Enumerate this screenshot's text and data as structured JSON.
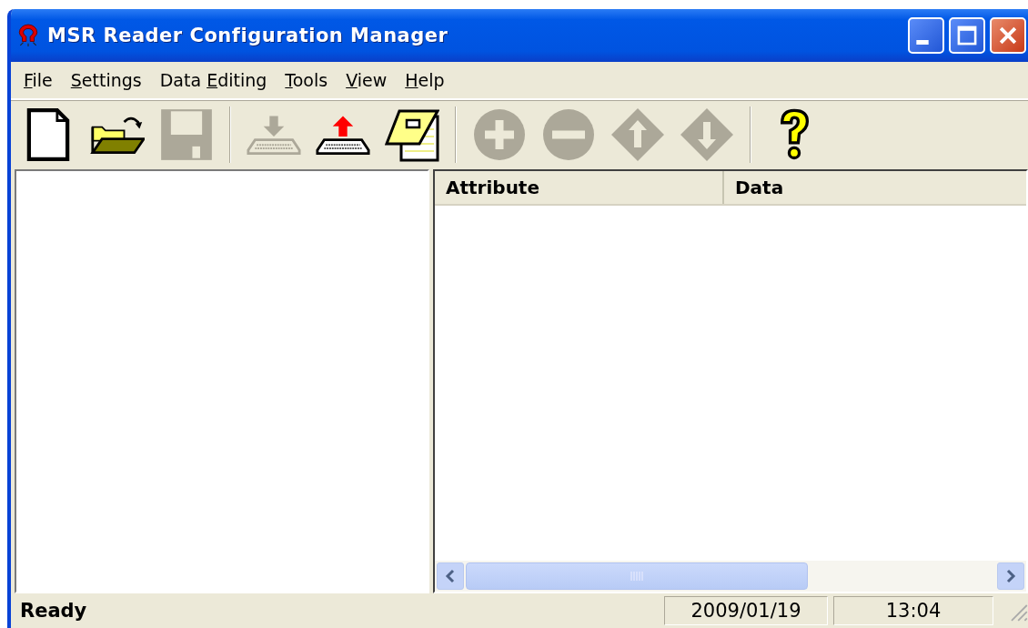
{
  "window": {
    "title": "MSR Reader Configuration Manager"
  },
  "menu": [
    {
      "key": "F",
      "post": "ile"
    },
    {
      "key": "S",
      "post": "ettings"
    },
    {
      "pre": "Data ",
      "key": "E",
      "post": "diting"
    },
    {
      "key": "T",
      "post": "ools"
    },
    {
      "key": "V",
      "post": "iew"
    },
    {
      "key": "H",
      "post": "elp"
    }
  ],
  "toolbar": [
    [
      {
        "kind": "new",
        "disabled": false
      },
      {
        "kind": "open",
        "disabled": false
      },
      {
        "kind": "save",
        "disabled": true
      }
    ],
    [
      {
        "kind": "download",
        "disabled": true
      },
      {
        "kind": "upload",
        "disabled": false
      },
      {
        "kind": "notepad",
        "disabled": false
      }
    ],
    [
      {
        "kind": "add",
        "disabled": true
      },
      {
        "kind": "remove",
        "disabled": true
      },
      {
        "kind": "up",
        "disabled": true
      },
      {
        "kind": "down",
        "disabled": true
      }
    ],
    [
      {
        "kind": "help",
        "disabled": false
      }
    ]
  ],
  "table": {
    "columns": [
      "Attribute",
      "Data"
    ]
  },
  "status_bar": {
    "message": "Ready",
    "date": "2009/01/19",
    "time": "13:04"
  }
}
